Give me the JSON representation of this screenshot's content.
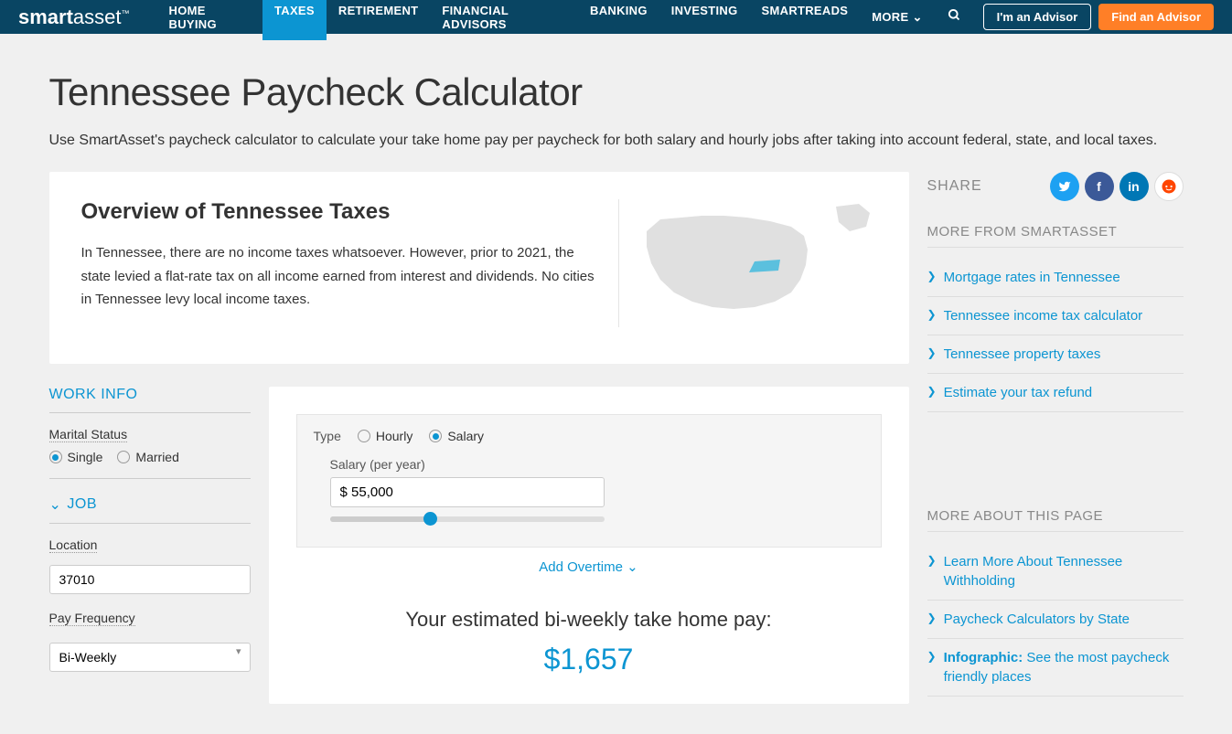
{
  "nav": {
    "logo_prefix": "smart",
    "logo_suffix": "asset",
    "items": [
      "HOME BUYING",
      "TAXES",
      "RETIREMENT",
      "FINANCIAL ADVISORS",
      "BANKING",
      "INVESTING",
      "SMARTREADS",
      "MORE"
    ],
    "active_index": 1,
    "im_advisor": "I'm an Advisor",
    "find_advisor": "Find an Advisor"
  },
  "page": {
    "title": "Tennessee Paycheck Calculator",
    "description": "Use SmartAsset's paycheck calculator to calculate your take home pay per paycheck for both salary and hourly jobs after taking into account federal, state, and local taxes."
  },
  "overview": {
    "title": "Overview of Tennessee Taxes",
    "text": "In Tennessee, there are no income taxes whatsoever. However, prior to 2021, the state levied a flat-rate tax on all income earned from interest and dividends. No cities in Tennessee levy local income taxes."
  },
  "share": {
    "label": "SHARE"
  },
  "more_from": {
    "heading": "MORE FROM SMARTASSET",
    "links": [
      "Mortgage rates in Tennessee",
      "Tennessee income tax calculator",
      "Tennessee property taxes",
      "Estimate your tax refund"
    ]
  },
  "more_about": {
    "heading": "MORE ABOUT THIS PAGE",
    "links": [
      {
        "text": "Learn More About Tennessee Withholding"
      },
      {
        "text": "Paycheck Calculators by State"
      },
      {
        "bold": "Infographic:",
        "text": " See the most paycheck friendly places"
      }
    ]
  },
  "work_info": {
    "heading": "WORK INFO",
    "marital_label": "Marital Status",
    "marital_options": [
      "Single",
      "Married"
    ],
    "marital_selected": 0,
    "job_heading": "JOB",
    "location_label": "Location",
    "location_value": "37010",
    "frequency_label": "Pay Frequency",
    "frequency_value": "Bi-Weekly"
  },
  "calc": {
    "type_label": "Type",
    "type_options": [
      "Hourly",
      "Salary"
    ],
    "type_selected": 1,
    "salary_label": "Salary (per year)",
    "salary_value": "$ 55,000",
    "add_overtime": "Add Overtime",
    "result_label": "Your estimated bi-weekly take home pay:",
    "result_value": "$1,657"
  }
}
